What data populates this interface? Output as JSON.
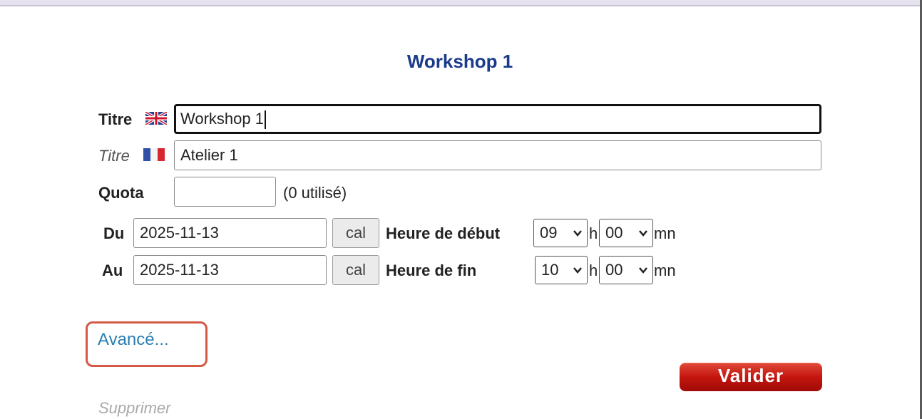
{
  "form": {
    "heading": "Workshop 1",
    "title_en": {
      "label": "Titre",
      "value": "Workshop 1",
      "flag": "uk-flag"
    },
    "title_fr": {
      "label": "Titre",
      "value": "Atelier 1",
      "flag": "fr-flag"
    },
    "quota": {
      "label": "Quota",
      "value": "",
      "used_text": "(0 utilisé)"
    },
    "from": {
      "label": "Du",
      "date": "2025-11-13",
      "cal_label": "cal",
      "time_label": "Heure de début",
      "hour": "09",
      "h_sep": "h",
      "minute": "00",
      "mn_sep": "mn"
    },
    "to": {
      "label": "Au",
      "date": "2025-11-13",
      "cal_label": "cal",
      "time_label": "Heure de fin",
      "hour": "10",
      "h_sep": "h",
      "minute": "00",
      "mn_sep": "mn"
    },
    "advanced_link": "Avancé...",
    "submit_label": "Valider",
    "delete_link": "Supprimer"
  },
  "colors": {
    "heading": "#1a3a8c",
    "link": "#2a7fb0",
    "highlight": "#d35a45",
    "submit": "#c4160f"
  }
}
